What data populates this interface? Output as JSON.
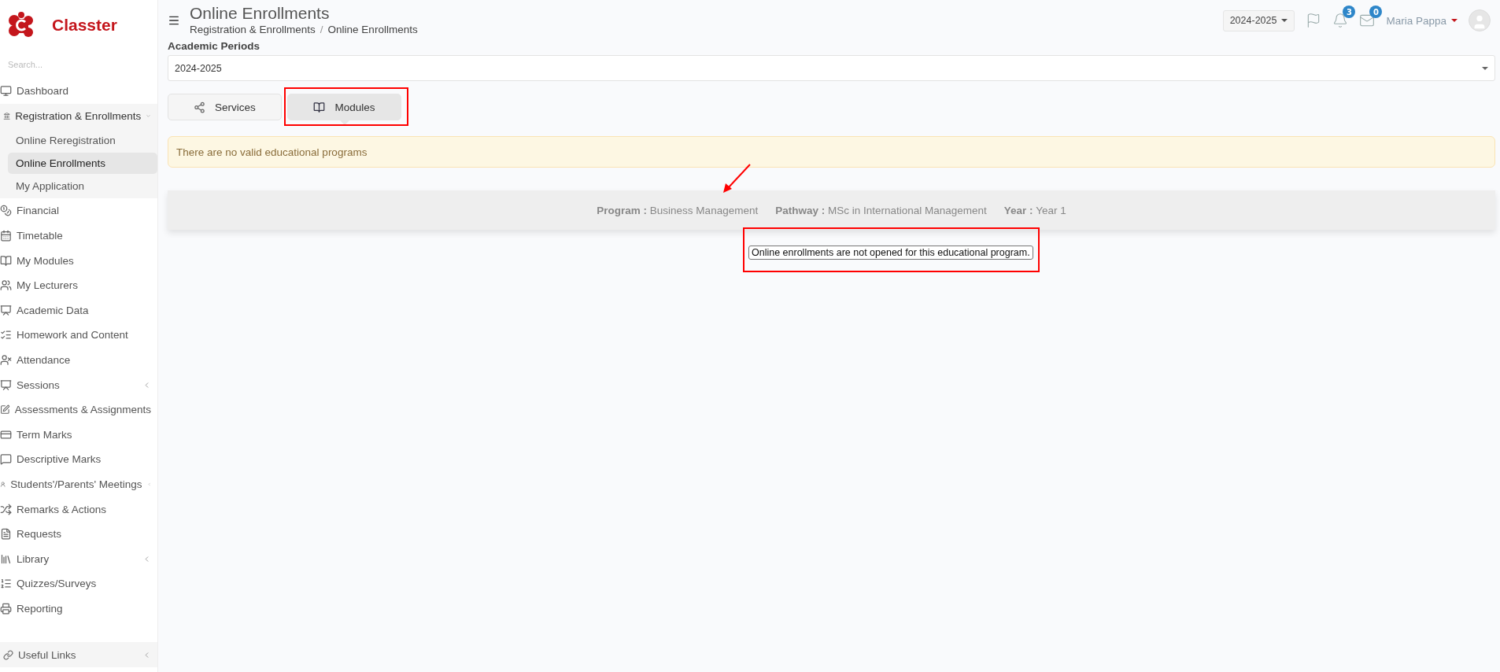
{
  "brand": {
    "name": "Classter"
  },
  "sidebar": {
    "search_placeholder": "Search...",
    "items": [
      {
        "label": "Dashboard"
      },
      {
        "label": "Registration & Enrollments",
        "expanded": true,
        "children": [
          {
            "label": "Online Reregistration",
            "selected": false
          },
          {
            "label": "Online Enrollments",
            "selected": true
          },
          {
            "label": "My Application",
            "selected": false
          }
        ]
      },
      {
        "label": "Financial"
      },
      {
        "label": "Timetable"
      },
      {
        "label": "My Modules"
      },
      {
        "label": "My Lecturers"
      },
      {
        "label": "Academic Data"
      },
      {
        "label": "Homework and Content"
      },
      {
        "label": "Attendance"
      },
      {
        "label": "Sessions",
        "expanded": false
      },
      {
        "label": "Assessments & Assignments"
      },
      {
        "label": "Term Marks"
      },
      {
        "label": "Descriptive Marks"
      },
      {
        "label": "Students'/Parents' Meetings",
        "expanded": false
      },
      {
        "label": "Remarks & Actions"
      },
      {
        "label": "Requests"
      },
      {
        "label": "Library",
        "expanded": false
      },
      {
        "label": "Quizzes/Surveys"
      },
      {
        "label": "Reporting"
      }
    ],
    "footer_item": {
      "label": "Useful Links",
      "expanded": false
    }
  },
  "header": {
    "title": "Online Enrollments",
    "breadcrumb": [
      "Registration & Enrollments",
      "Online Enrollments"
    ],
    "breadcrumb_separator": "/",
    "year": "2024-2025",
    "notifications": "3",
    "messages": "0",
    "user": "Maria Pappa"
  },
  "academic_periods": {
    "label": "Academic Periods",
    "value": "2024-2025"
  },
  "tabs": [
    {
      "label": "Services",
      "selected": false
    },
    {
      "label": "Modules",
      "selected": true
    }
  ],
  "alert": "There are no valid educational programs",
  "program_info": [
    {
      "label": "Program :",
      "value": "Business Management"
    },
    {
      "label": "Pathway :",
      "value": "MSc in International Management"
    },
    {
      "label": "Year :",
      "value": "Year 1"
    }
  ],
  "message": "Online enrollments are not opened for this educational program."
}
